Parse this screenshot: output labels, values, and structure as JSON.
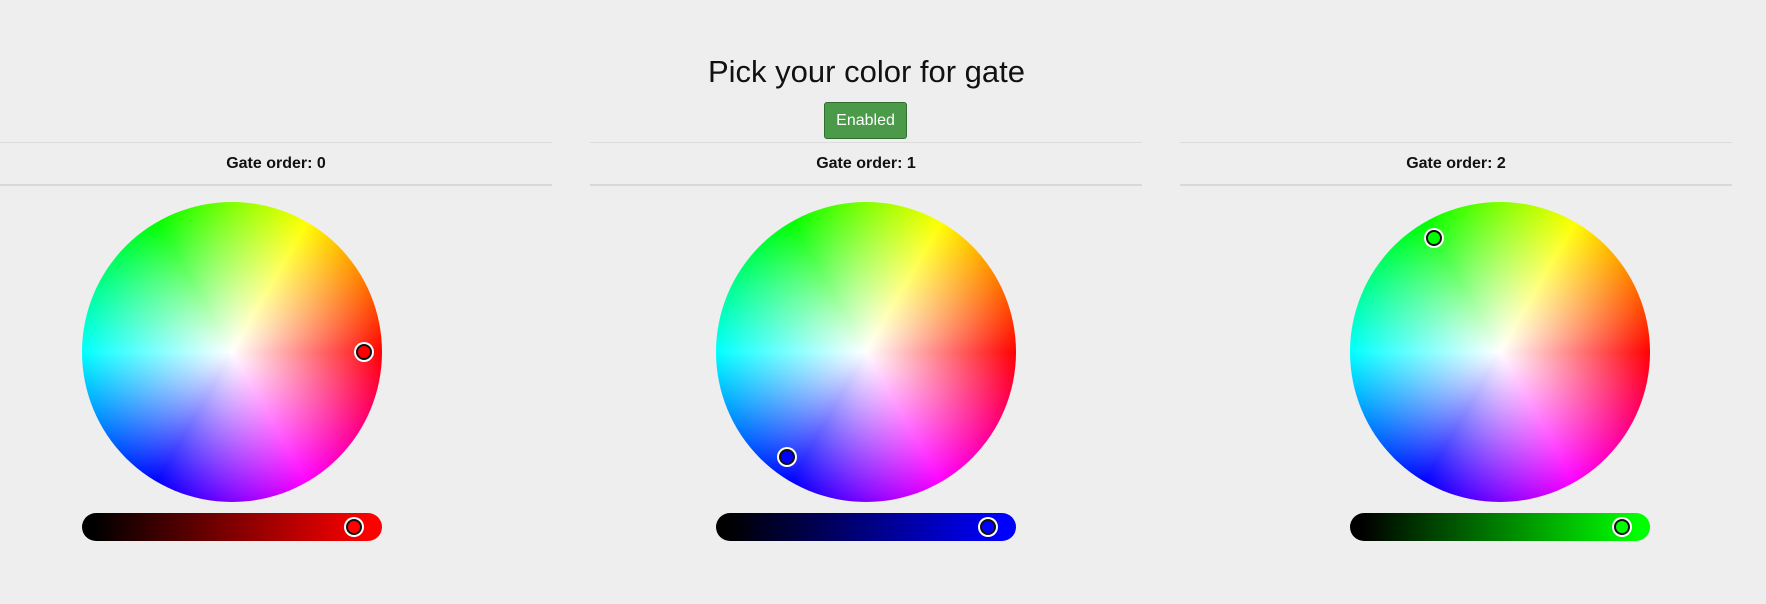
{
  "title": "Pick your color for gate",
  "enable_button": {
    "label": "Enabled",
    "color": "#4a9a4a"
  },
  "gates": [
    {
      "header": "Gate order: 0",
      "color": "#ff0000",
      "hue_deg": 0,
      "saturation": 0.88,
      "brightness": 0.95
    },
    {
      "header": "Gate order: 1",
      "color": "#0000ff",
      "hue_deg": 233,
      "saturation": 0.88,
      "brightness": 0.95
    },
    {
      "header": "Gate order: 2",
      "color": "#00ff00",
      "hue_deg": 120,
      "saturation": 0.88,
      "brightness": 0.95
    }
  ]
}
